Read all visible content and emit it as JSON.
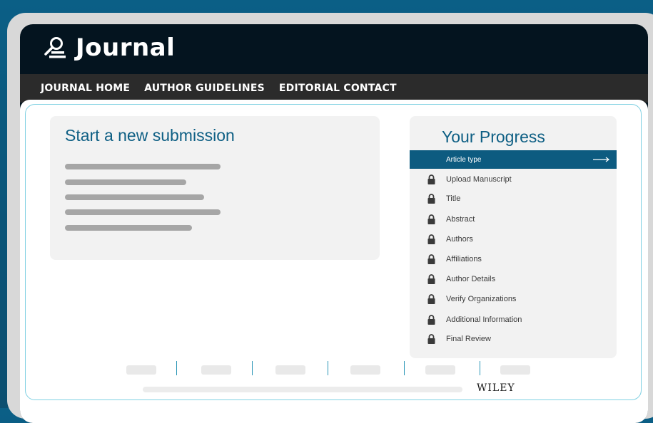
{
  "header": {
    "title": "Journal",
    "logo_icon": "search-person-icon"
  },
  "nav": {
    "items": [
      {
        "label": "JOURNAL HOME"
      },
      {
        "label": "AUTHOR GUIDELINES"
      },
      {
        "label": "EDITORIAL CONTACT"
      }
    ]
  },
  "submission": {
    "title": "Start a new submission"
  },
  "progress": {
    "title": "Your Progress",
    "active_step": "Article type",
    "active_icon": "arrow-right-icon",
    "locked_icon": "lock-icon",
    "steps": [
      {
        "label": "Upload Manuscript"
      },
      {
        "label": "Title"
      },
      {
        "label": "Abstract"
      },
      {
        "label": "Authors"
      },
      {
        "label": "Affiliations"
      },
      {
        "label": "Author Details"
      },
      {
        "label": "Verify Organizations"
      },
      {
        "label": "Additional Information"
      },
      {
        "label": "Final Review"
      }
    ]
  },
  "footer": {
    "brand": "WILEY"
  },
  "colors": {
    "brand": "#0e5f84",
    "active_step_bg": "#0d5b80",
    "nav_bg": "#2b2b2b",
    "header_bg": "#04141f"
  }
}
